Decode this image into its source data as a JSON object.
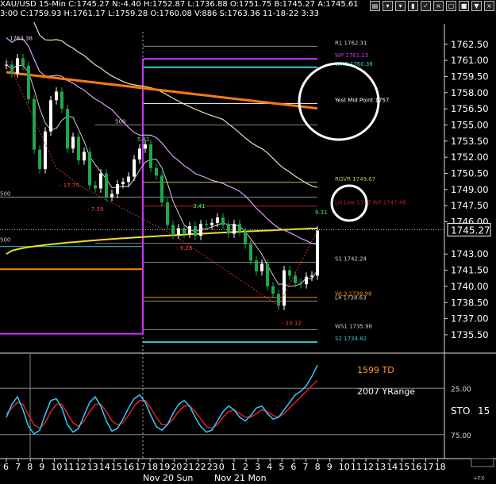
{
  "header": {
    "line1": "XAU/USD 15-Min C:1745.27 N:-4.40 H:1752.87 L:1736.88 O:1751.75 B:1745.27 A:1745.61",
    "line2": "3:00 C:1759.93 H:1761.17 L:1759.28 O:1760.08 V:886 S:1763.36 11-18-22 3:33"
  },
  "toolbar": {
    "icons": [
      "chart-icon",
      "pin-icon",
      "pin-icon-2",
      "bar-icon",
      "check-icon",
      "close-icon",
      "window-icon",
      "box-icon",
      "down-icon",
      "close-icon-2"
    ]
  },
  "colors": {
    "background": "#000000",
    "price_line": "#ffffff",
    "candle_up": "#ffffff",
    "candle_down": "#1ea84b",
    "sma_fast": "#cfcfcf",
    "sma_mid": "#e0a0ff",
    "sma_slow_yellowish": "#e4e4b4",
    "ma_orange": "#ff7a10",
    "ma_yellow": "#f0e020",
    "level_magenta": "#cc33ff",
    "level_cyan": "#33cccc",
    "level_white": "#ffffff",
    "level_gray": "#888888",
    "level_red": "#b22222",
    "level_orange": "#ff8800",
    "stoch_k": "#33ccff",
    "stoch_d": "#dd2222",
    "zigzag_red": "#cc3333"
  },
  "chart_data": {
    "type": "candlestick",
    "symbol": "XAU/USD",
    "timeframe": "15-Min",
    "price_axis": {
      "ticks": [
        "1762.50",
        "1761.00",
        "1759.50",
        "1758.00",
        "1756.50",
        "1755.00",
        "1753.50",
        "1752.00",
        "1750.50",
        "1749.00",
        "1747.50",
        "1746.00",
        "1745.27",
        "1743.00",
        "1741.50",
        "1740.00",
        "1738.50",
        "1737.00",
        "1735.50"
      ],
      "tick_values": [
        1762.5,
        1761.0,
        1759.5,
        1758.0,
        1756.5,
        1755.0,
        1753.5,
        1752.0,
        1750.5,
        1749.0,
        1747.5,
        1746.0,
        1745.27,
        1743.0,
        1741.5,
        1740.0,
        1738.5,
        1737.0,
        1735.5
      ],
      "last_price_label": "1745.27",
      "range": [
        1733.8,
        1764.4
      ]
    },
    "time_axis": {
      "labels": [
        "6",
        "7",
        "8",
        "9",
        "10",
        "11",
        "12",
        "13",
        "14",
        "15",
        "16",
        "17",
        "18",
        "19",
        "20",
        "21",
        "22",
        "23",
        "0",
        "1",
        "2",
        "3",
        "4",
        "5",
        "6",
        "7",
        "8",
        "9",
        "10",
        "11",
        "12",
        "13",
        "14",
        "15",
        "16",
        "17",
        "18"
      ],
      "date_labels": [
        "Nov 20 Sun",
        "Nov 21 Mon"
      ]
    },
    "price_series": [
      1760.6,
      1759.8,
      1761.2,
      1760.5,
      1757.4,
      1752.7,
      1750.9,
      1754.4,
      1757.3,
      1758.1,
      1756.5,
      1752.8,
      1753.9,
      1751.7,
      1752.5,
      1749.4,
      1749.1,
      1750.5,
      1748.3,
      1748.6,
      1749.5,
      1749.7,
      1750.2,
      1751.8,
      1752.8,
      1753.2,
      1751.0,
      1750.3,
      1747.8,
      1745.7,
      1744.8,
      1745.4,
      1744.9,
      1745.6,
      1744.7,
      1745.8,
      1745.7,
      1745.9,
      1746.4,
      1745.7,
      1744.9,
      1745.8,
      1745.1,
      1743.9,
      1742.4,
      1741.4,
      1742.1,
      1740.0,
      1739.3,
      1738.2,
      1741.5,
      1741.0,
      1740.3,
      1740.2,
      1740.9,
      1741.0,
      1745.2
    ],
    "levels": [
      {
        "label": "R1 1762.31",
        "value": 1762.31,
        "color": "#888888"
      },
      {
        "label": "WP 1761.15",
        "value": 1761.15,
        "color": "#cc33ff"
      },
      {
        "label": "WH3 1760.36",
        "value": 1760.36,
        "color": "#33cccc"
      },
      {
        "label": "Yest Mid Point 1757",
        "value": 1757.0,
        "color": "#ffffff"
      },
      {
        "label": "500",
        "value": 1755.0,
        "color": "#888888"
      },
      {
        "label": "RGVR 1749.67",
        "value": 1749.67,
        "color": "#bbbb55"
      },
      {
        "label": "500",
        "value": 1748.3,
        "color": "#888888"
      },
      {
        "label": "LH Low 1747 WP 1747.46",
        "value": 1747.46,
        "color": "#b22222"
      },
      {
        "label": "500",
        "value": 1744.0,
        "color": "#888888"
      },
      {
        "label": "S1 1742.24",
        "value": 1742.24,
        "color": "#888888"
      },
      {
        "label": "WL3 1738.98",
        "value": 1738.98,
        "color": "#ff8800"
      },
      {
        "label": "L4 1738.63",
        "value": 1738.63,
        "color": "#888888"
      },
      {
        "label": "WS1 1735.98",
        "value": 1735.98,
        "color": "#888888"
      },
      {
        "label": "S2 1734.82",
        "value": 1734.82,
        "color": "#33cccc"
      }
    ],
    "annotations": [
      "1763.38",
      "- 17.75",
      "- 7.59",
      "5.41",
      "3.41",
      "- 9.28",
      "9.31",
      "- 10.12"
    ],
    "stochastic": {
      "label": "STO",
      "value_label": "15",
      "levels": [
        "25.00",
        "75.00"
      ],
      "level_values": [
        25,
        75
      ],
      "k": [
        58,
        44,
        36,
        50,
        68,
        76,
        72,
        55,
        40,
        38,
        48,
        66,
        74,
        70,
        56,
        42,
        36,
        46,
        62,
        73,
        70,
        60,
        48,
        38,
        34,
        42,
        56,
        68,
        72,
        66,
        54,
        44,
        40,
        46,
        58,
        68,
        74,
        72,
        62,
        52,
        46,
        50,
        58,
        62,
        56,
        48,
        46,
        54,
        60,
        58,
        50,
        42,
        34,
        30,
        24,
        14,
        2
      ],
      "d": [
        54,
        48,
        42,
        44,
        56,
        66,
        70,
        64,
        52,
        44,
        44,
        54,
        64,
        68,
        62,
        52,
        44,
        44,
        52,
        62,
        66,
        64,
        56,
        46,
        40,
        40,
        48,
        58,
        66,
        66,
        60,
        52,
        46,
        46,
        52,
        60,
        68,
        70,
        66,
        58,
        52,
        50,
        54,
        58,
        58,
        54,
        50,
        52,
        56,
        58,
        54,
        48,
        42,
        36,
        30,
        24,
        18
      ]
    },
    "text_labels": [
      "1599 TD",
      "2007 YRange"
    ],
    "footer": "+FX"
  }
}
